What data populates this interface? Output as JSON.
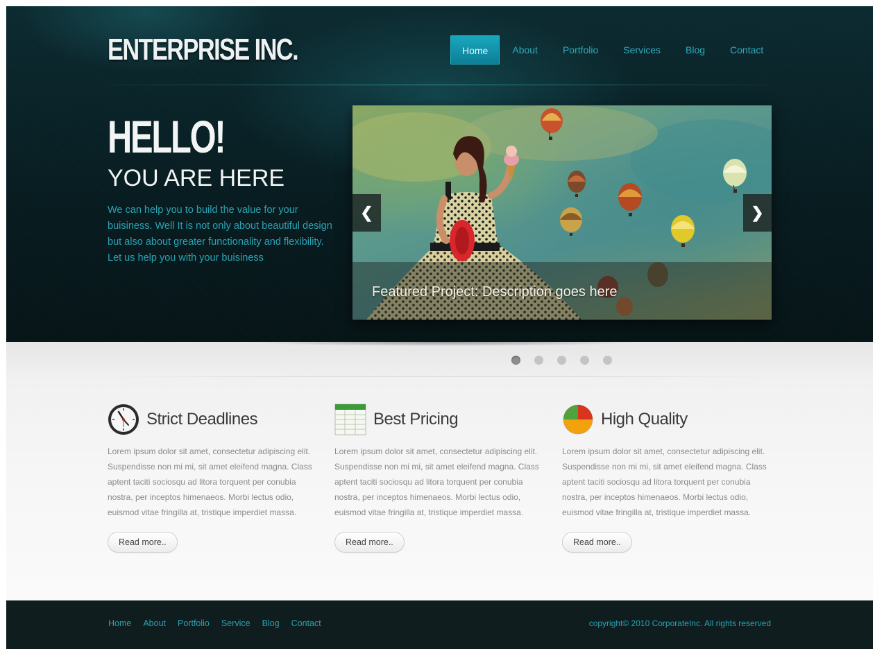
{
  "header": {
    "logo": "ENTERPRISE INC.",
    "nav": [
      "Home",
      "About",
      "Portfolio",
      "Services",
      "Blog",
      "Contact"
    ],
    "active_nav": "Home"
  },
  "hero": {
    "headline": "HELLO!",
    "subheadline": "YOU ARE HERE",
    "intro": "We can help you to build the value for your buisiness. Well It is not only about beautiful design but also about greater functionality and flexibility. Let us help you with your buisiness",
    "slider": {
      "caption": "Featured Project: Description goes here",
      "prev_label": "❮",
      "next_label": "❯",
      "slide_count": 5,
      "active_slide": 1
    }
  },
  "features": [
    {
      "icon": "clock-icon",
      "title": "Strict Deadlines",
      "text": "Lorem ipsum dolor sit amet, consectetur adipiscing elit. Suspendisse non mi mi, sit amet eleifend magna. Class aptent taciti sociosqu ad litora torquent per conubia nostra, per inceptos himenaeos. Morbi lectus odio, euismod vitae fringilla at, tristique imperdiet massa.",
      "button": "Read more.."
    },
    {
      "icon": "spreadsheet-icon",
      "title": "Best Pricing",
      "text": "Lorem ipsum dolor sit amet, consectetur adipiscing elit. Suspendisse non mi mi, sit amet eleifend magna. Class aptent taciti sociosqu ad litora torquent per conubia nostra, per inceptos himenaeos. Morbi lectus odio, euismod vitae fringilla at, tristique imperdiet massa.",
      "button": "Read more.."
    },
    {
      "icon": "pie-chart-icon",
      "title": "High Quality",
      "text": "Lorem ipsum dolor sit amet, consectetur adipiscing elit. Suspendisse non mi mi, sit amet eleifend magna. Class aptent taciti sociosqu ad litora torquent per conubia nostra, per inceptos himenaeos. Morbi lectus odio, euismod vitae fringilla at, tristique imperdiet massa.",
      "button": "Read more.."
    }
  ],
  "footer": {
    "nav": [
      "Home",
      "About",
      "Portfolio",
      "Service",
      "Blog",
      "Contact"
    ],
    "copyright": "copyright© 2010 CorporateInc. All rights reserved"
  },
  "colors": {
    "accent": "#2aa3b4",
    "header_bg": "#0b2a30",
    "footer_bg": "#0f1d1e",
    "nav_active": "#1aa7bf"
  }
}
